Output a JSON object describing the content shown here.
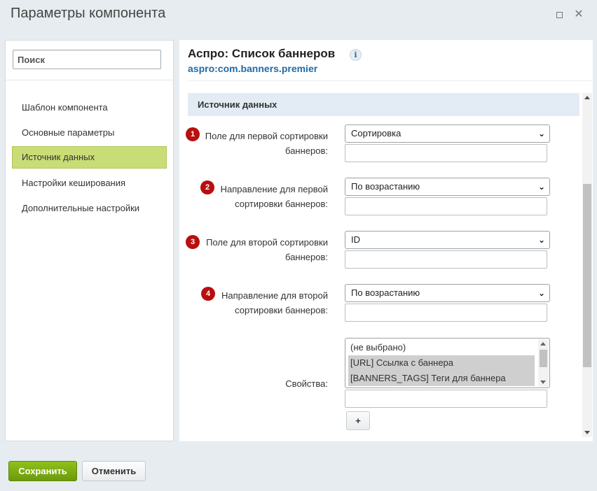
{
  "window": {
    "title": "Параметры компонента"
  },
  "sidebar": {
    "search_placeholder": "Поиск",
    "items": [
      {
        "label": "Шаблон компонента",
        "active": false
      },
      {
        "label": "Основные параметры",
        "active": false
      },
      {
        "label": "Источник данных",
        "active": true
      },
      {
        "label": "Настройки кеширования",
        "active": false
      },
      {
        "label": "Дополнительные настройки",
        "active": false
      }
    ]
  },
  "component": {
    "title": "Аспро: Список баннеров",
    "info_glyph": "i",
    "code": "aspro:com.banners.premier"
  },
  "section": {
    "title": "Источник данных"
  },
  "params": [
    {
      "badge": "1",
      "label_line1": "Поле для первой сортировки",
      "label_line2": "баннеров:",
      "value": "Сортировка"
    },
    {
      "badge": "2",
      "label_line1": "Направление для первой",
      "label_line2": "сортировки баннеров:",
      "value": "По возрастанию"
    },
    {
      "badge": "3",
      "label_line1": "Поле для второй сортировки",
      "label_line2": "баннеров:",
      "value": "ID"
    },
    {
      "badge": "4",
      "label_line1": "Направление для второй",
      "label_line2": "сортировки баннеров:",
      "value": "По возрастанию"
    }
  ],
  "properties": {
    "label": "Свойства:",
    "options": [
      {
        "label": "(не выбрано)",
        "selected": false
      },
      {
        "label": "[URL] Ссылка с баннера",
        "selected": true
      },
      {
        "label": "[BANNERS_TAGS] Теги для баннера",
        "selected": true
      }
    ],
    "add_label": "+"
  },
  "footer": {
    "save_label": "Сохранить",
    "cancel_label": "Отменить"
  },
  "colors": {
    "accent_active": "#c9dd76",
    "badge": "#b80f0f",
    "save_button": "#7aab12",
    "link": "#1e6aa8",
    "section_header": "#e3ecf4"
  },
  "icons": [
    "maximize-icon",
    "close-icon",
    "info-icon",
    "chevron-down-icon",
    "scroll-up-icon",
    "scroll-down-icon"
  ]
}
